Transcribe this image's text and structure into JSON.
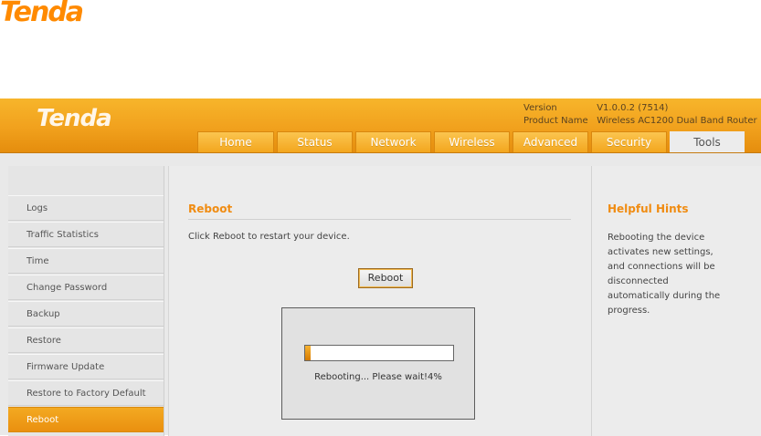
{
  "brand": {
    "logo": "Tenda"
  },
  "header": {
    "logo": "Tenda",
    "version_label": "Version",
    "version_value": "V1.0.0.2 (7514)",
    "product_label": "Product Name",
    "product_value": "Wireless AC1200 Dual Band Router"
  },
  "tabs": [
    "Home",
    "Status",
    "Network",
    "Wireless",
    "Advanced",
    "Security",
    "Tools"
  ],
  "active_tab": "Tools",
  "sidebar": {
    "items": [
      "Logs",
      "Traffic Statistics",
      "Time",
      "Change Password",
      "Backup",
      "Restore",
      "Firmware Update",
      "Restore to Factory Default",
      "Reboot"
    ],
    "active_item": "Reboot"
  },
  "main": {
    "title": "Reboot",
    "description": "Click Reboot to restart your device.",
    "button_label": "Reboot",
    "progress_text": "Rebooting... Please wait!4%",
    "progress_percent": 4
  },
  "hints": {
    "title": "Helpful Hints",
    "text": "Rebooting the device activates new settings, and connections will be disconnected automatically during the progress."
  },
  "colors": {
    "accent": "#f1a11d",
    "active_text": "#f08c12"
  }
}
